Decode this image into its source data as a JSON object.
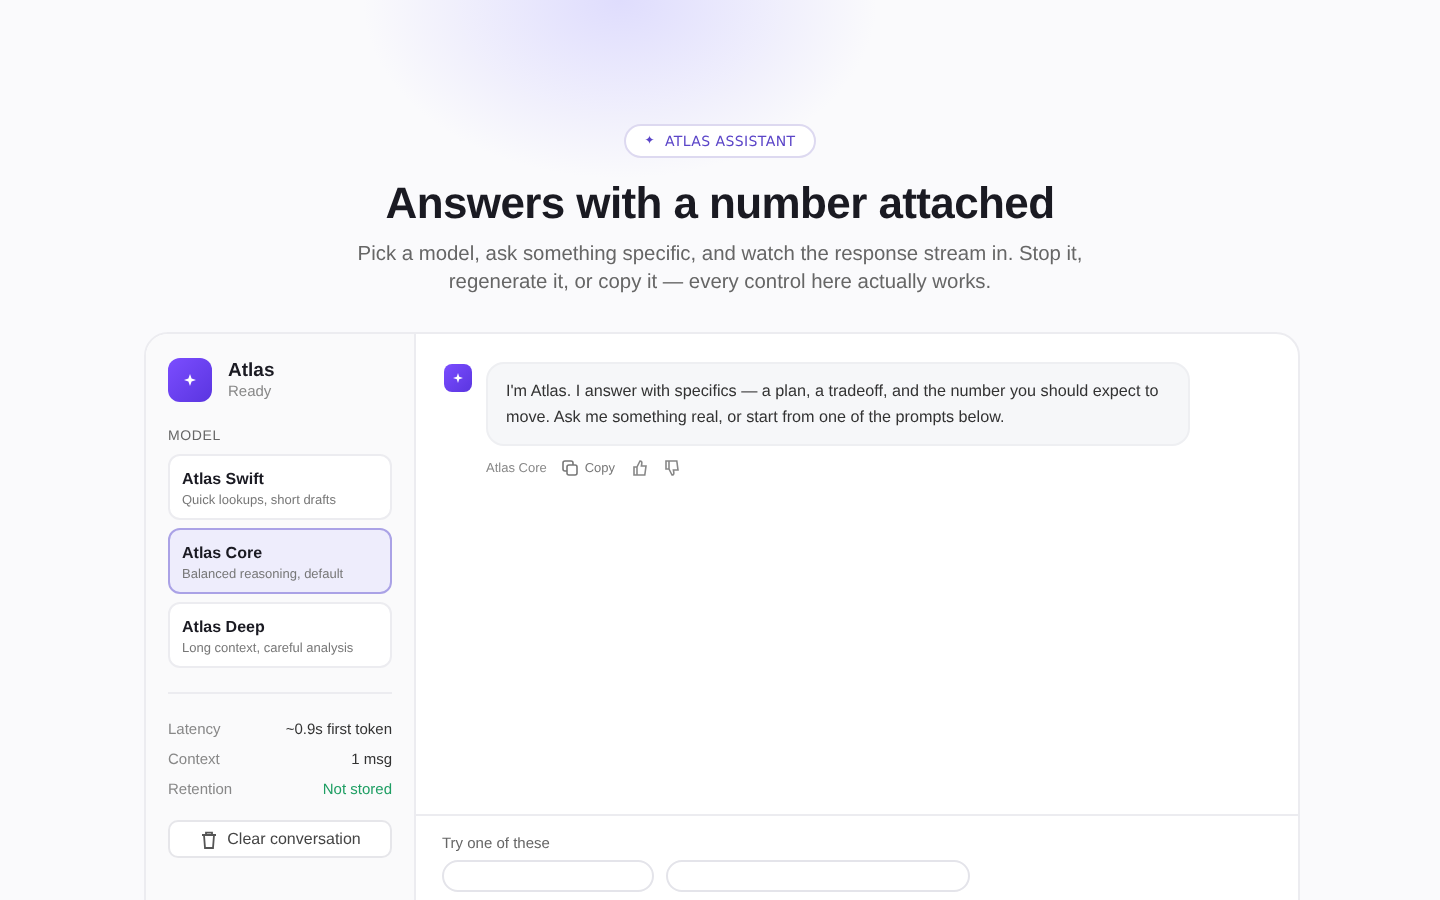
{
  "badge": {
    "icon": "✦",
    "label": "ATLAS ASSISTANT"
  },
  "title": "Answers with a number attached",
  "subtitle": "Pick a model, ask something specific, and watch the response stream in. Stop it, regenerate it, or copy it — every control here actually works.",
  "assistant": {
    "name": "Atlas",
    "status": "Ready"
  },
  "model_heading": "MODEL",
  "models": [
    {
      "name": "Atlas Swift",
      "description": "Quick lookups, short drafts",
      "selected": false
    },
    {
      "name": "Atlas Core",
      "description": "Balanced reasoning, default",
      "selected": true
    },
    {
      "name": "Atlas Deep",
      "description": "Long context, careful analysis",
      "selected": false
    }
  ],
  "stats": [
    {
      "label": "Latency",
      "value": "~0.9s first token",
      "kind": "plain"
    },
    {
      "label": "Context",
      "value": "1 msg",
      "kind": "plain"
    },
    {
      "label": "Retention",
      "value": "Not stored",
      "kind": "good"
    }
  ],
  "clear_button": "Clear conversation",
  "messages": [
    {
      "text": "I'm Atlas. I answer with specifics — a plan, a tradeoff, and the number you should expect to move. Ask me something real, or start from one of the prompts below.",
      "model": "Atlas Core",
      "copy": "Copy"
    }
  ],
  "prompts_heading": "Try one of these"
}
